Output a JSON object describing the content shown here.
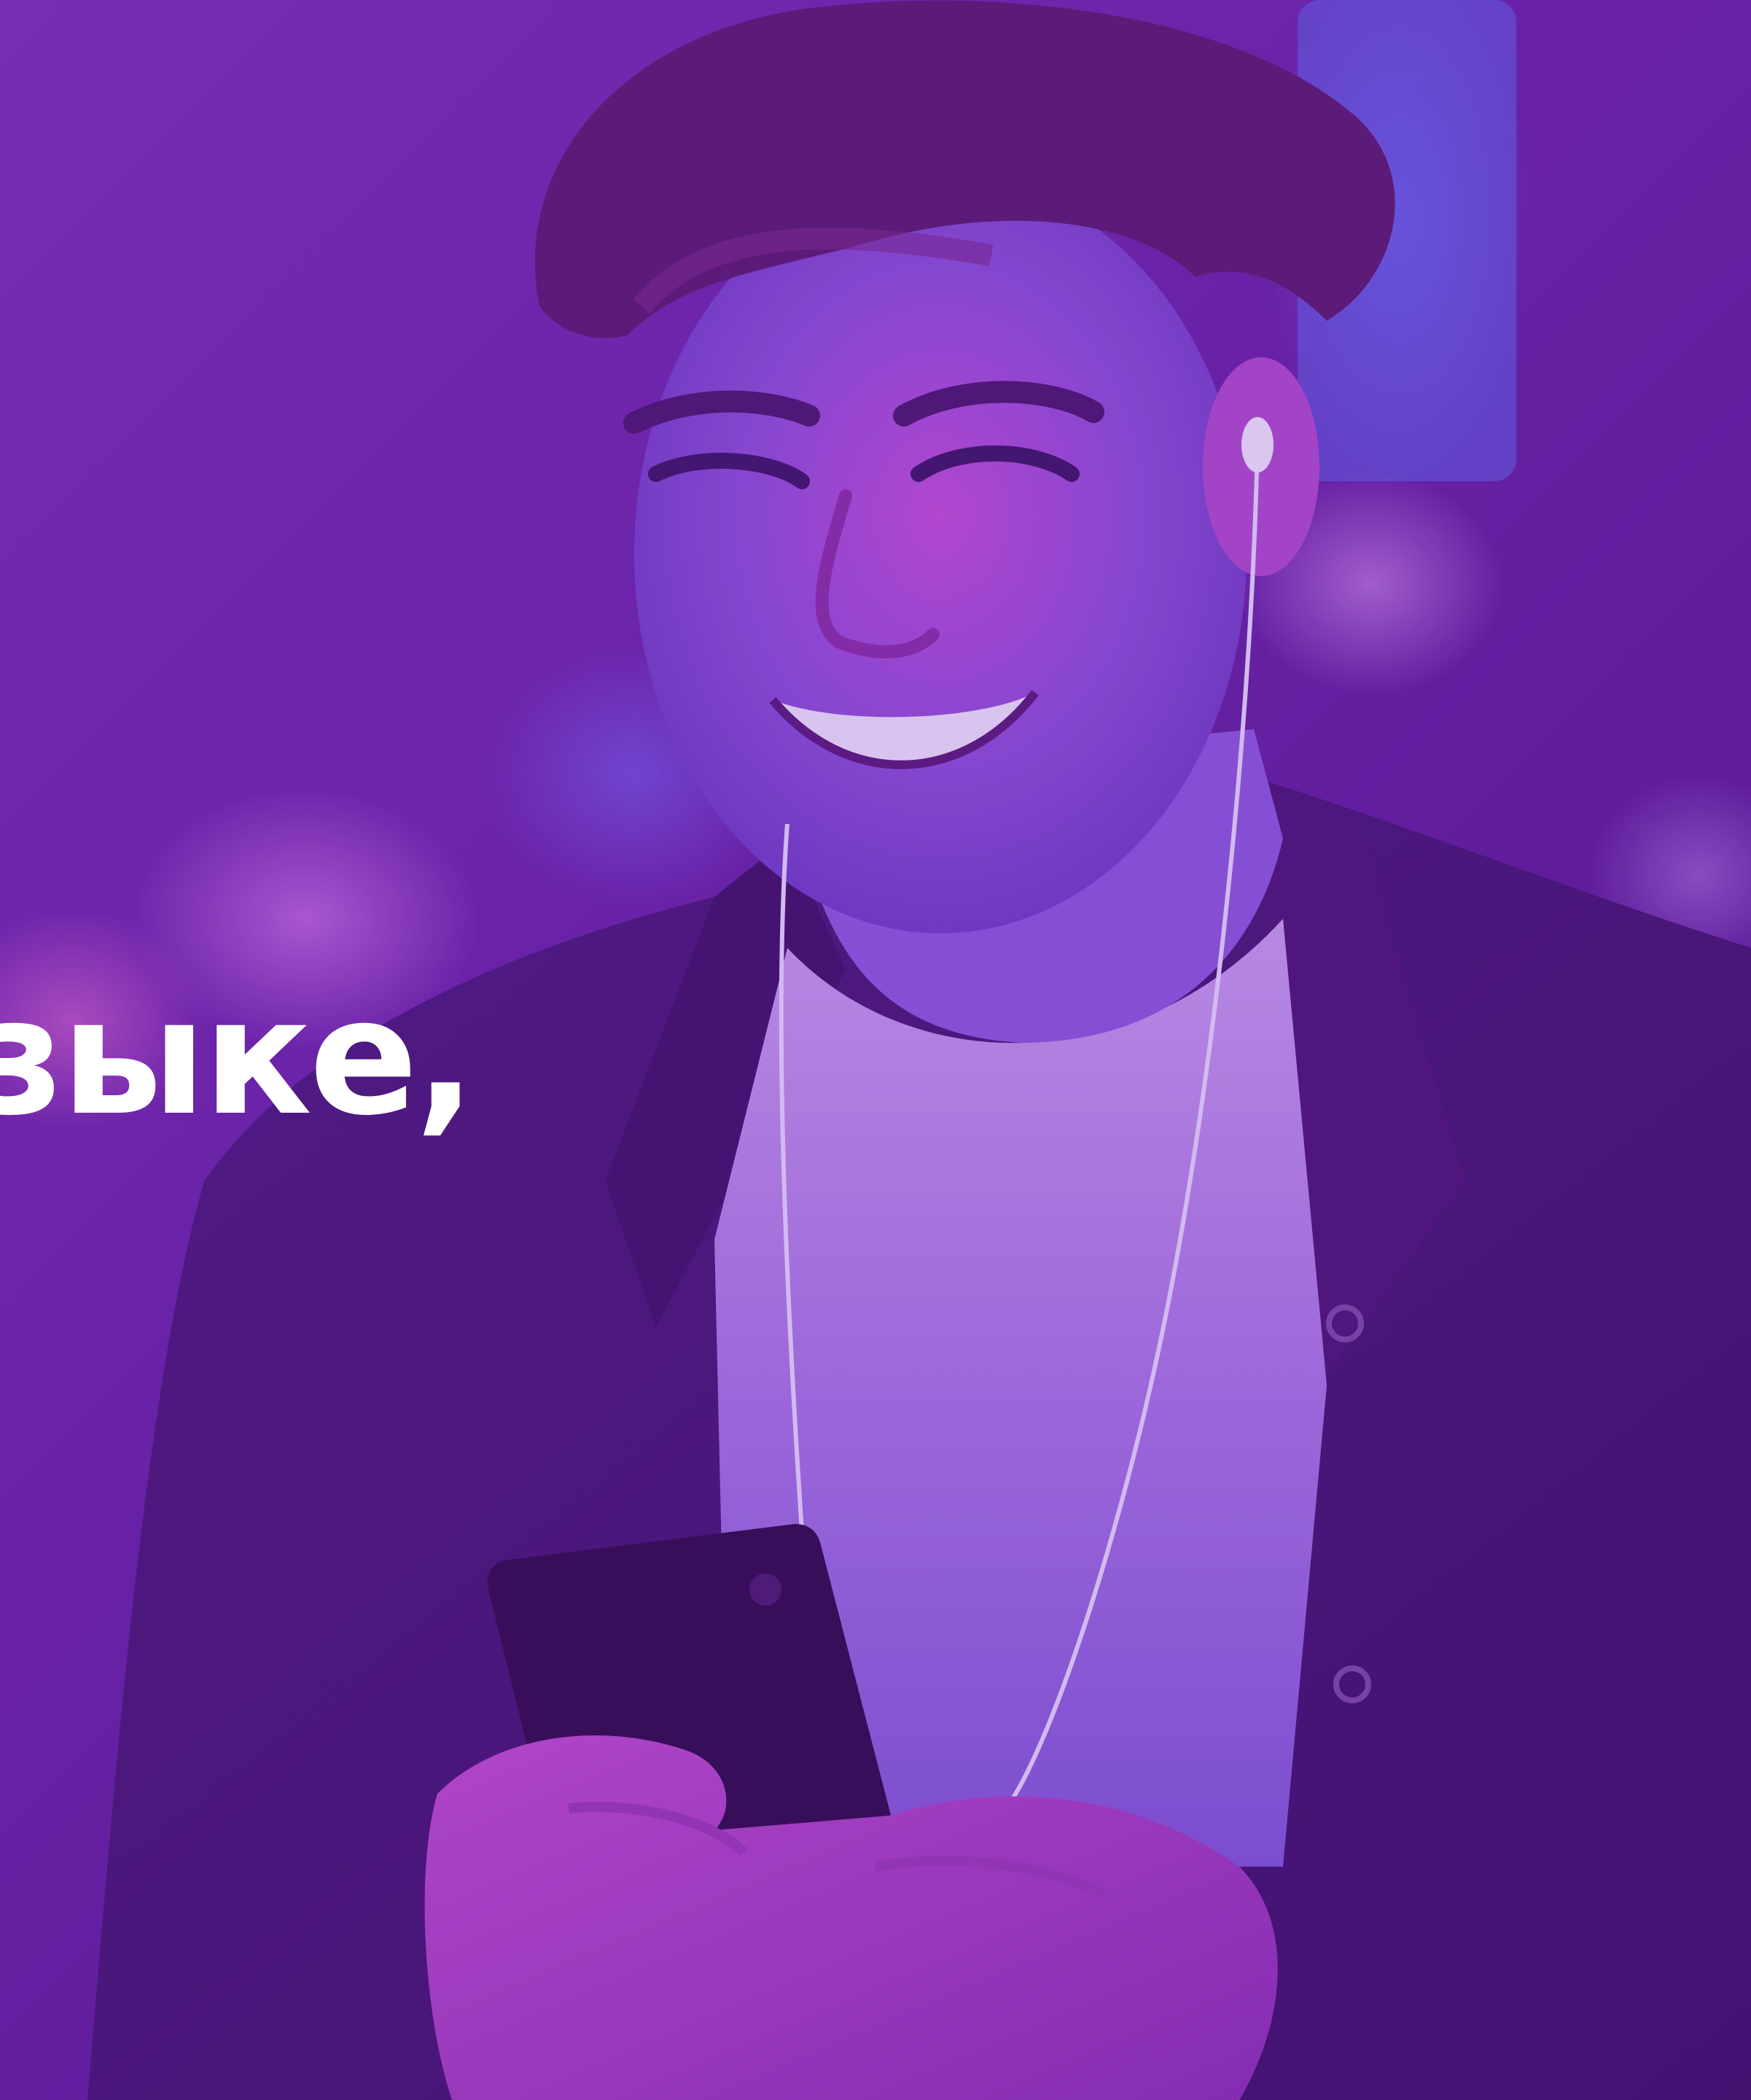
{
  "headline": {
    "text": "зыке,"
  },
  "photo": {
    "icon": "person-listening-to-music-on-phone-photo"
  },
  "colors": {
    "overlay": "#6a23a8",
    "text": "#ffffff"
  }
}
